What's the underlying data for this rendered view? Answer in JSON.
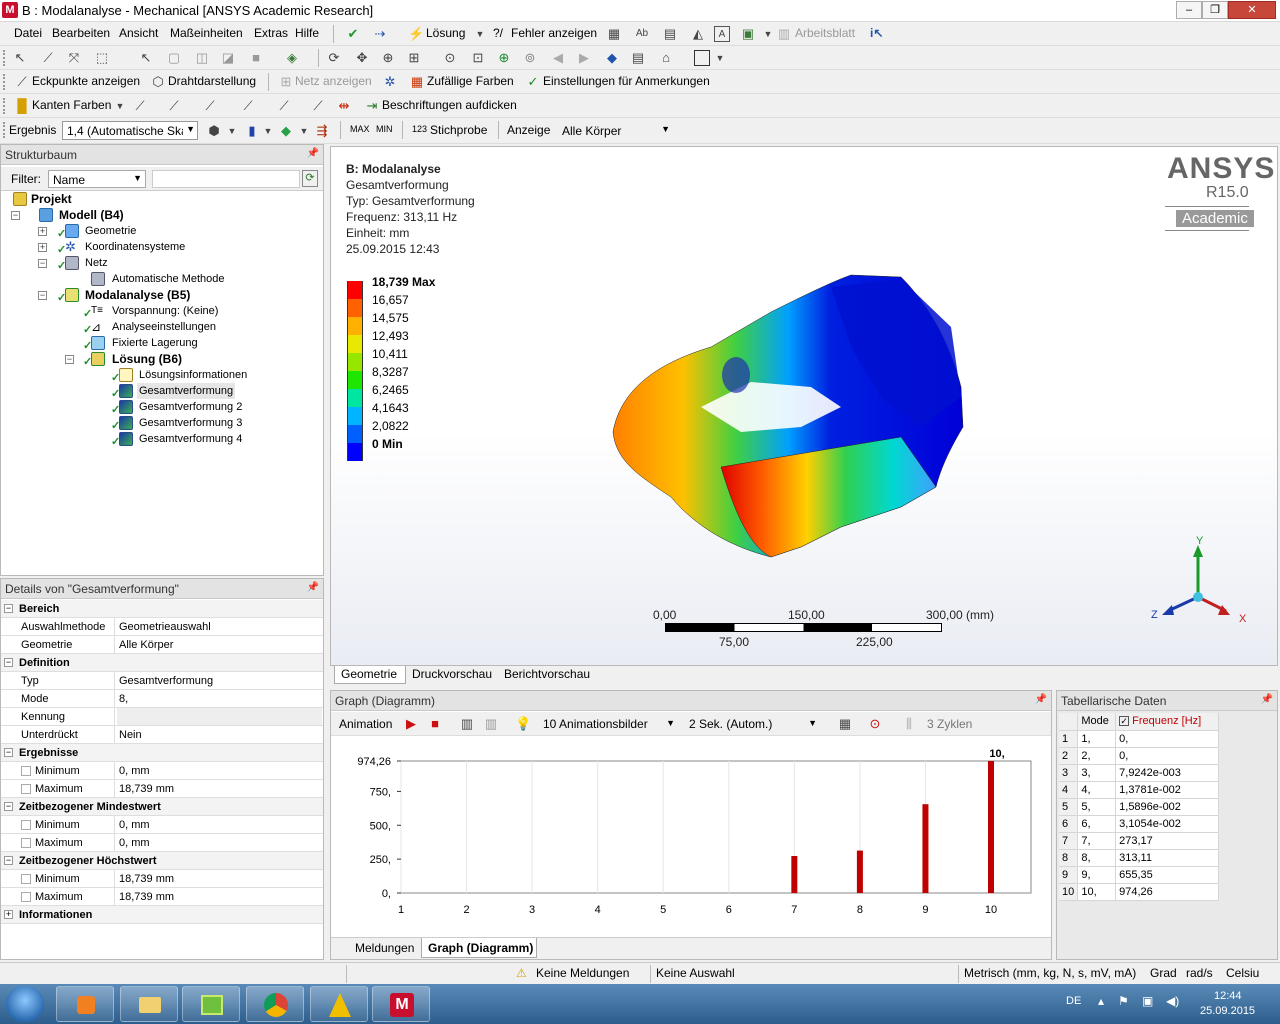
{
  "window": {
    "title": "B : Modalanalyse - Mechanical [ANSYS Academic Research]"
  },
  "menu": [
    "Datei",
    "Bearbeiten",
    "Ansicht",
    "Maßeinheiten",
    "Extras",
    "Hilfe"
  ],
  "toolbar1": {
    "solve": "Lösung",
    "show_errors": "Fehler anzeigen",
    "worksheet": "Arbeitsblatt"
  },
  "toolbar3": {
    "vertices": "Eckpunkte anzeigen",
    "wireframe": "Drahtdarstellung",
    "show_mesh": "Netz anzeigen",
    "random_colors": "Zufällige Farben",
    "annotation_prefs": "Einstellungen für Anmerkungen"
  },
  "toolbar4": {
    "edge_colors": "Kanten Farben",
    "thicken": "Beschriftungen aufdicken"
  },
  "toolbar5": {
    "result_label": "Ergebnis",
    "result_scale": "1,4 (Automatische Skal",
    "probe": "Stichprobe",
    "display_label": "Anzeige",
    "display_value": "Alle Körper"
  },
  "tree": {
    "title": "Strukturbaum",
    "filter_label": "Filter:",
    "filter_value": "Name",
    "nodes": [
      "Projekt",
      "Modell (B4)",
      "Geometrie",
      "Koordinatensysteme",
      "Netz",
      "Automatische Methode",
      "Modalanalyse (B5)",
      "Vorspannung: (Keine)",
      "Analyseeinstellungen",
      "Fixierte Lagerung",
      "Lösung (B6)",
      "Lösungsinformationen",
      "Gesamtverformung",
      "Gesamtverformung 2",
      "Gesamtverformung 3",
      "Gesamtverformung 4"
    ]
  },
  "details": {
    "title": "Details von \"Gesamtverformung\"",
    "groups": {
      "bereich": "Bereich",
      "definition": "Definition",
      "ergebnisse": "Ergebnisse",
      "min_zeit": "Zeitbezogener Mindestwert",
      "max_zeit": "Zeitbezogener Höchstwert",
      "info": "Informationen"
    },
    "rows": {
      "auswahl_k": "Auswahlmethode",
      "auswahl_v": "Geometrieauswahl",
      "geo_k": "Geometrie",
      "geo_v": "Alle Körper",
      "typ_k": "Typ",
      "typ_v": "Gesamtverformung",
      "mode_k": "Mode",
      "mode_v": "8,",
      "kennung_k": "Kennung",
      "kennung_v": "",
      "unter_k": "Unterdrückt",
      "unter_v": "Nein",
      "min_k": "Minimum",
      "min_v": "0, mm",
      "max_k": "Maximum",
      "max_v": "18,739 mm",
      "zmin_min_v": "0, mm",
      "zmin_max_v": "0, mm",
      "zmax_min_v": "18,739 mm",
      "zmax_max_v": "18,739 mm"
    }
  },
  "viewport": {
    "header": [
      "B: Modalanalyse",
      "Gesamtverformung",
      "Typ: Gesamtverformung",
      "Frequenz: 313,11 Hz",
      "Einheit: mm",
      "25.09.2015 12:43"
    ],
    "brand": "ANSYS",
    "version": "R15.0",
    "edition": "Academic",
    "legend": [
      "18,739 Max",
      "16,657",
      "14,575",
      "12,493",
      "10,411",
      "8,3287",
      "6,2465",
      "4,1643",
      "2,0822",
      "0 Min"
    ],
    "legend_colors": [
      "#ff0000",
      "#ff6000",
      "#ffb000",
      "#e8e800",
      "#96e600",
      "#1ee600",
      "#00e6a0",
      "#00b4ff",
      "#0060ff",
      "#0000ff"
    ],
    "scale": {
      "t0": "0,00",
      "t150": "150,00",
      "t300": "300,00 (mm)",
      "t75": "75,00",
      "t225": "225,00"
    },
    "triad": {
      "y": "Y",
      "z": "Z",
      "x": "X"
    },
    "tabs": [
      "Geometrie",
      "Druckvorschau",
      "Berichtvorschau"
    ]
  },
  "graph": {
    "title": "Graph (Diagramm)",
    "animation": "Animation",
    "frames": "10 Animationsbilder",
    "duration": "2 Sek. (Autom.)",
    "cycles": "3 Zyklen",
    "tabs": [
      "Meldungen",
      "Graph (Diagramm)"
    ]
  },
  "chart_data": {
    "type": "bar",
    "categories": [
      "1",
      "2",
      "3",
      "4",
      "5",
      "6",
      "7",
      "8",
      "9",
      "10"
    ],
    "values": [
      0,
      0,
      0.0079242,
      0.013781,
      0.015896,
      0.031054,
      273.17,
      313.11,
      655.35,
      974.26
    ],
    "y_ticks": [
      "0,",
      "250,",
      "500,",
      "750,",
      "974,26"
    ],
    "ylim": [
      0,
      974.26
    ],
    "top_label": "10,",
    "bar_color": "#c00000"
  },
  "table": {
    "title": "Tabellarische Daten",
    "col_mode": "Mode",
    "col_freq": "Frequenz [Hz]",
    "rows": [
      [
        "1",
        "1,",
        "0,"
      ],
      [
        "2",
        "2,",
        "0,"
      ],
      [
        "3",
        "3,",
        "7,9242e-003"
      ],
      [
        "4",
        "4,",
        "1,3781e-002"
      ],
      [
        "5",
        "5,",
        "1,5896e-002"
      ],
      [
        "6",
        "6,",
        "3,1054e-002"
      ],
      [
        "7",
        "7,",
        "273,17"
      ],
      [
        "8",
        "8,",
        "313,11"
      ],
      [
        "9",
        "9,",
        "655,35"
      ],
      [
        "10",
        "10,",
        "974,26"
      ]
    ]
  },
  "statusbar": {
    "messages": "Keine Meldungen",
    "selection": "Keine Auswahl",
    "units": "Metrisch (mm, kg, N, s, mV, mA)",
    "deg": "Grad",
    "rad": "rad/s",
    "temp": "Celsiu"
  },
  "taskbar": {
    "lang": "DE",
    "time": "12:44",
    "date": "25.09.2015"
  }
}
